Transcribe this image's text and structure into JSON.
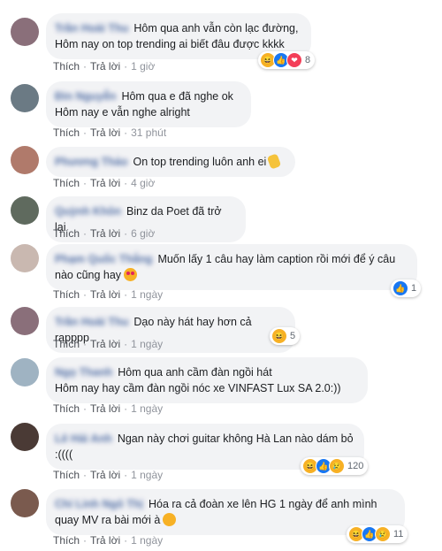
{
  "actions": {
    "like_label": "Thích",
    "reply_label": "Trả lời"
  },
  "comments": [
    {
      "author": "Trần Hoài Thu",
      "text": "Hôm qua anh vẫn còn lạc đường,\nHôm nay on top trending ai biết đâu được kkkk",
      "time": "1 giờ",
      "reactions": [
        "haha",
        "like",
        "love"
      ],
      "reaction_count": "8",
      "avatar_color": "#8a6f7a"
    },
    {
      "author": "Đin Nguyễn",
      "text": "Hôm qua e đã nghe ok\nHôm nay e vẫn nghe alright",
      "time": "31 phút",
      "reactions": [],
      "reaction_count": "",
      "avatar_color": "#6b7a84"
    },
    {
      "author": "Phương Thảo",
      "text": "On top trending luôn anh ei",
      "time": "4 giờ",
      "reactions": [],
      "reaction_count": "",
      "avatar_color": "#b07a6b"
    },
    {
      "author": "Quỳnh Khôn",
      "text": "Binz da Poet đã trở lại",
      "time": "6 giờ",
      "reactions": [],
      "reaction_count": "",
      "avatar_color": "#5f6a5e"
    },
    {
      "author": "Phạm Quốc Thắng",
      "text": "Muốn lấy 1 câu hay làm caption rồi mới để ý câu\nnào cũng hay",
      "time": "1 ngày",
      "reactions": [
        "like"
      ],
      "reaction_count": "1",
      "avatar_color": "#c9b8b0"
    },
    {
      "author": "Trần Hoài Thu",
      "text": "Dạo này hát hay hơn cả rapppp",
      "time": "1 ngày",
      "reactions": [
        "haha"
      ],
      "reaction_count": "5",
      "avatar_color": "#8a6f7a"
    },
    {
      "author": "Ngọ Thanh",
      "text": "Hôm qua anh cầm đàn ngồi hát\nHôm nay hay cầm đàn ngồi nóc xe VINFAST Lux SA 2.0:))",
      "time": "1 ngày",
      "reactions": [],
      "reaction_count": "",
      "avatar_color": "#9fb3c2"
    },
    {
      "author": "Lê Hải Anh",
      "text": "Ngan này chơi guitar không Hà Lan nào dám bỏ\n:((((",
      "time": "1 ngày",
      "reactions": [
        "haha",
        "like",
        "sad"
      ],
      "reaction_count": "120",
      "avatar_color": "#4a3a35"
    },
    {
      "author": "Chí Linh Ngô Thị",
      "text": "Hóa ra cả đoàn xe lên HG 1 ngày để anh mình\nquay MV ra bài mới à",
      "time": "1 ngày",
      "reactions": [
        "haha",
        "like",
        "sad"
      ],
      "reaction_count": "11",
      "avatar_color": "#7a5a4e"
    }
  ]
}
